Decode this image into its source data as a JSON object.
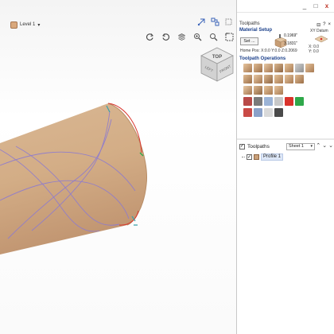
{
  "viewport": {
    "level_label": "Level 1",
    "cube": {
      "top": "TOP",
      "left": "LEFT",
      "front": "FRONT"
    }
  },
  "window": {
    "minimize": "_",
    "maximize": "□",
    "close": "x"
  },
  "toolpaths_panel": {
    "title": "Toolpaths",
    "material_setup": {
      "title": "Material Setup",
      "setup_button": "Set ...",
      "dim_top": "0.1969\"",
      "dim_height": "3.1831\"",
      "datum_label": "XY Datum",
      "x_value": "X: 0.0",
      "y_value": "Y: 0.0"
    },
    "home_pos": {
      "label": "Home Pos:",
      "value": "X:0.0 Y:0.0 Z:0.2069"
    },
    "operations_title": "Toolpath Operations"
  },
  "toolpath_list": {
    "title": "Toolpaths",
    "sheet_selected": "Sheet 1",
    "items": [
      {
        "label": "Profile 1",
        "checked": true
      }
    ]
  },
  "colors": {
    "cylinder": "#d4b08a",
    "accent_blue": "#1a3f8a",
    "toolpath_purple": "#8c7ad0",
    "boundary_red": "#d9332b"
  }
}
